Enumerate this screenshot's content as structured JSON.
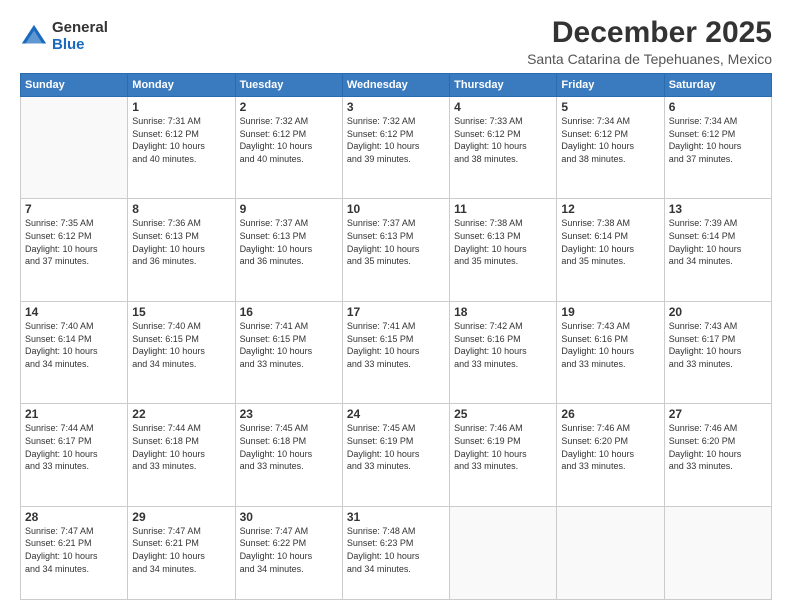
{
  "logo": {
    "general": "General",
    "blue": "Blue"
  },
  "title": "December 2025",
  "subtitle": "Santa Catarina de Tepehuanes, Mexico",
  "days_of_week": [
    "Sunday",
    "Monday",
    "Tuesday",
    "Wednesday",
    "Thursday",
    "Friday",
    "Saturday"
  ],
  "weeks": [
    [
      {
        "day": "",
        "info": ""
      },
      {
        "day": "1",
        "info": "Sunrise: 7:31 AM\nSunset: 6:12 PM\nDaylight: 10 hours\nand 40 minutes."
      },
      {
        "day": "2",
        "info": "Sunrise: 7:32 AM\nSunset: 6:12 PM\nDaylight: 10 hours\nand 40 minutes."
      },
      {
        "day": "3",
        "info": "Sunrise: 7:32 AM\nSunset: 6:12 PM\nDaylight: 10 hours\nand 39 minutes."
      },
      {
        "day": "4",
        "info": "Sunrise: 7:33 AM\nSunset: 6:12 PM\nDaylight: 10 hours\nand 38 minutes."
      },
      {
        "day": "5",
        "info": "Sunrise: 7:34 AM\nSunset: 6:12 PM\nDaylight: 10 hours\nand 38 minutes."
      },
      {
        "day": "6",
        "info": "Sunrise: 7:34 AM\nSunset: 6:12 PM\nDaylight: 10 hours\nand 37 minutes."
      }
    ],
    [
      {
        "day": "7",
        "info": "Sunrise: 7:35 AM\nSunset: 6:12 PM\nDaylight: 10 hours\nand 37 minutes."
      },
      {
        "day": "8",
        "info": "Sunrise: 7:36 AM\nSunset: 6:13 PM\nDaylight: 10 hours\nand 36 minutes."
      },
      {
        "day": "9",
        "info": "Sunrise: 7:37 AM\nSunset: 6:13 PM\nDaylight: 10 hours\nand 36 minutes."
      },
      {
        "day": "10",
        "info": "Sunrise: 7:37 AM\nSunset: 6:13 PM\nDaylight: 10 hours\nand 35 minutes."
      },
      {
        "day": "11",
        "info": "Sunrise: 7:38 AM\nSunset: 6:13 PM\nDaylight: 10 hours\nand 35 minutes."
      },
      {
        "day": "12",
        "info": "Sunrise: 7:38 AM\nSunset: 6:14 PM\nDaylight: 10 hours\nand 35 minutes."
      },
      {
        "day": "13",
        "info": "Sunrise: 7:39 AM\nSunset: 6:14 PM\nDaylight: 10 hours\nand 34 minutes."
      }
    ],
    [
      {
        "day": "14",
        "info": "Sunrise: 7:40 AM\nSunset: 6:14 PM\nDaylight: 10 hours\nand 34 minutes."
      },
      {
        "day": "15",
        "info": "Sunrise: 7:40 AM\nSunset: 6:15 PM\nDaylight: 10 hours\nand 34 minutes."
      },
      {
        "day": "16",
        "info": "Sunrise: 7:41 AM\nSunset: 6:15 PM\nDaylight: 10 hours\nand 33 minutes."
      },
      {
        "day": "17",
        "info": "Sunrise: 7:41 AM\nSunset: 6:15 PM\nDaylight: 10 hours\nand 33 minutes."
      },
      {
        "day": "18",
        "info": "Sunrise: 7:42 AM\nSunset: 6:16 PM\nDaylight: 10 hours\nand 33 minutes."
      },
      {
        "day": "19",
        "info": "Sunrise: 7:43 AM\nSunset: 6:16 PM\nDaylight: 10 hours\nand 33 minutes."
      },
      {
        "day": "20",
        "info": "Sunrise: 7:43 AM\nSunset: 6:17 PM\nDaylight: 10 hours\nand 33 minutes."
      }
    ],
    [
      {
        "day": "21",
        "info": "Sunrise: 7:44 AM\nSunset: 6:17 PM\nDaylight: 10 hours\nand 33 minutes."
      },
      {
        "day": "22",
        "info": "Sunrise: 7:44 AM\nSunset: 6:18 PM\nDaylight: 10 hours\nand 33 minutes."
      },
      {
        "day": "23",
        "info": "Sunrise: 7:45 AM\nSunset: 6:18 PM\nDaylight: 10 hours\nand 33 minutes."
      },
      {
        "day": "24",
        "info": "Sunrise: 7:45 AM\nSunset: 6:19 PM\nDaylight: 10 hours\nand 33 minutes."
      },
      {
        "day": "25",
        "info": "Sunrise: 7:46 AM\nSunset: 6:19 PM\nDaylight: 10 hours\nand 33 minutes."
      },
      {
        "day": "26",
        "info": "Sunrise: 7:46 AM\nSunset: 6:20 PM\nDaylight: 10 hours\nand 33 minutes."
      },
      {
        "day": "27",
        "info": "Sunrise: 7:46 AM\nSunset: 6:20 PM\nDaylight: 10 hours\nand 33 minutes."
      }
    ],
    [
      {
        "day": "28",
        "info": "Sunrise: 7:47 AM\nSunset: 6:21 PM\nDaylight: 10 hours\nand 34 minutes."
      },
      {
        "day": "29",
        "info": "Sunrise: 7:47 AM\nSunset: 6:21 PM\nDaylight: 10 hours\nand 34 minutes."
      },
      {
        "day": "30",
        "info": "Sunrise: 7:47 AM\nSunset: 6:22 PM\nDaylight: 10 hours\nand 34 minutes."
      },
      {
        "day": "31",
        "info": "Sunrise: 7:48 AM\nSunset: 6:23 PM\nDaylight: 10 hours\nand 34 minutes."
      },
      {
        "day": "",
        "info": ""
      },
      {
        "day": "",
        "info": ""
      },
      {
        "day": "",
        "info": ""
      }
    ]
  ]
}
